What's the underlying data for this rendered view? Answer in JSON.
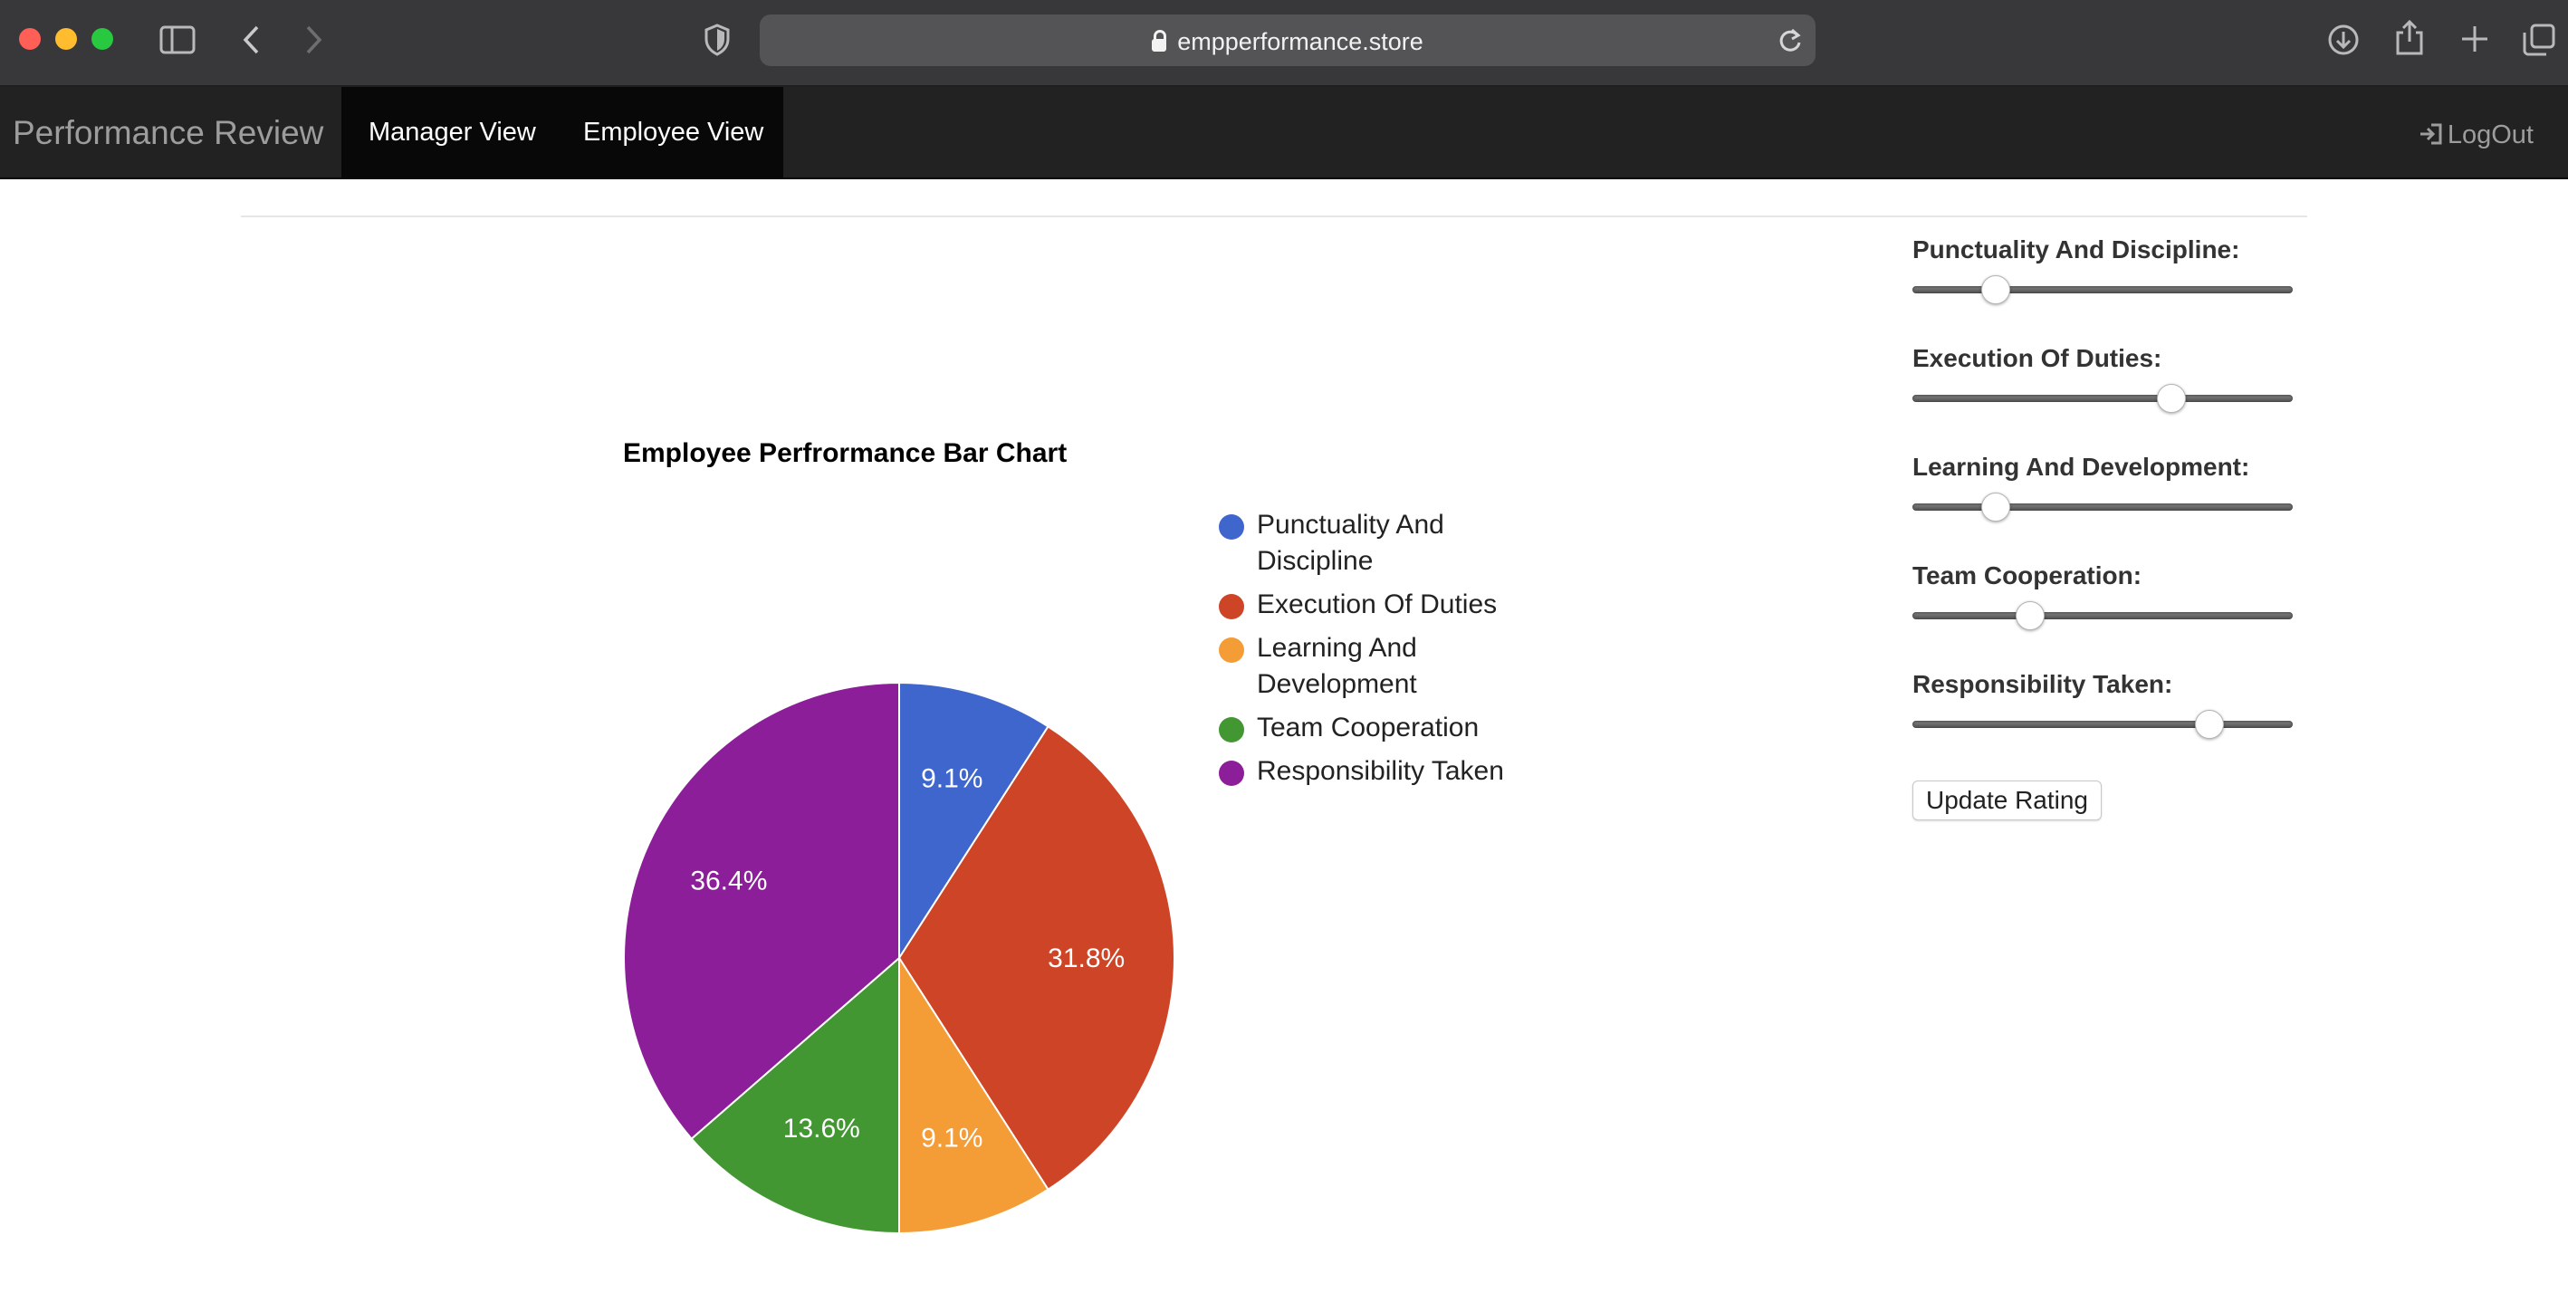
{
  "browser": {
    "url": "empperformance.store",
    "icons": [
      "sidebar-icon",
      "back-icon",
      "forward-icon",
      "shield-icon",
      "reload-icon",
      "download-icon",
      "share-icon",
      "new-tab-icon",
      "tabs-overview-icon"
    ]
  },
  "navbar": {
    "brand": "Performance Review",
    "links": [
      "Manager View",
      "Employee View"
    ],
    "logout": "LogOut"
  },
  "chart_data": {
    "type": "pie",
    "title": "Employee Perfrormance Bar Chart",
    "categories": [
      "Punctuality And Discipline",
      "Execution Of Duties",
      "Learning And Development",
      "Team Cooperation",
      "Responsibility Taken"
    ],
    "values": [
      9.1,
      31.8,
      9.1,
      13.6,
      36.4
    ],
    "labels": [
      "9.1%",
      "31.8%",
      "9.1%",
      "13.6%",
      "36.4%"
    ],
    "colors": [
      "#3e66cc",
      "#cd4526",
      "#f49d37",
      "#429733",
      "#8c1f99"
    ],
    "legend_position": "right"
  },
  "legend": {
    "items": [
      {
        "label_line1": "Punctuality And",
        "label_line2": "Discipline",
        "color": "#3e66cc"
      },
      {
        "label_line1": "Execution Of Duties",
        "label_line2": "",
        "color": "#cd4526"
      },
      {
        "label_line1": "Learning And",
        "label_line2": "Development",
        "color": "#f49d37"
      },
      {
        "label_line1": "Team Cooperation",
        "label_line2": "",
        "color": "#429733"
      },
      {
        "label_line1": "Responsibility Taken",
        "label_line2": "",
        "color": "#8c1f99"
      }
    ]
  },
  "ratings": {
    "fields": [
      {
        "label": "Punctuality And Discipline:",
        "level": 0.22
      },
      {
        "label": "Execution Of Duties:",
        "level": 0.68
      },
      {
        "label": "Learning And Development:",
        "level": 0.22
      },
      {
        "label": "Team Cooperation:",
        "level": 0.31
      },
      {
        "label": "Responsibility Taken:",
        "level": 0.78
      }
    ],
    "update_label": "Update Rating"
  }
}
